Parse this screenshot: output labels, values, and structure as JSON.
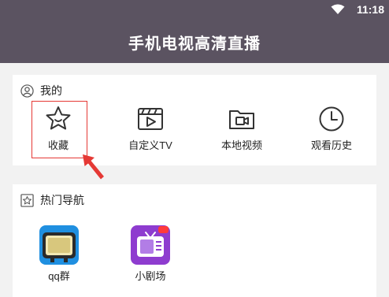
{
  "status_bar": {
    "time": "11:18",
    "wifi_icon": "wifi-icon"
  },
  "app_bar": {
    "title": "手机电视高清直播"
  },
  "my_section": {
    "title": "我的",
    "icon": "user-icon",
    "items": [
      {
        "label": "收藏",
        "icon": "star-icon"
      },
      {
        "label": "自定义TV",
        "icon": "clapperboard-icon"
      },
      {
        "label": "本地视频",
        "icon": "video-folder-icon"
      },
      {
        "label": "观看历史",
        "icon": "clock-icon"
      }
    ]
  },
  "hot_nav_section": {
    "title": "热门导航",
    "icon": "star-box-icon",
    "items": [
      {
        "label": "qq群",
        "icon": "retro-tv-app-icon"
      },
      {
        "label": "小剧场",
        "icon": "tv-theater-app-icon"
      }
    ]
  },
  "colors": {
    "primary": "#5b5361",
    "highlight": "#e53935",
    "background": "#f2f2f2",
    "purple_app": "#8e3ccf"
  }
}
